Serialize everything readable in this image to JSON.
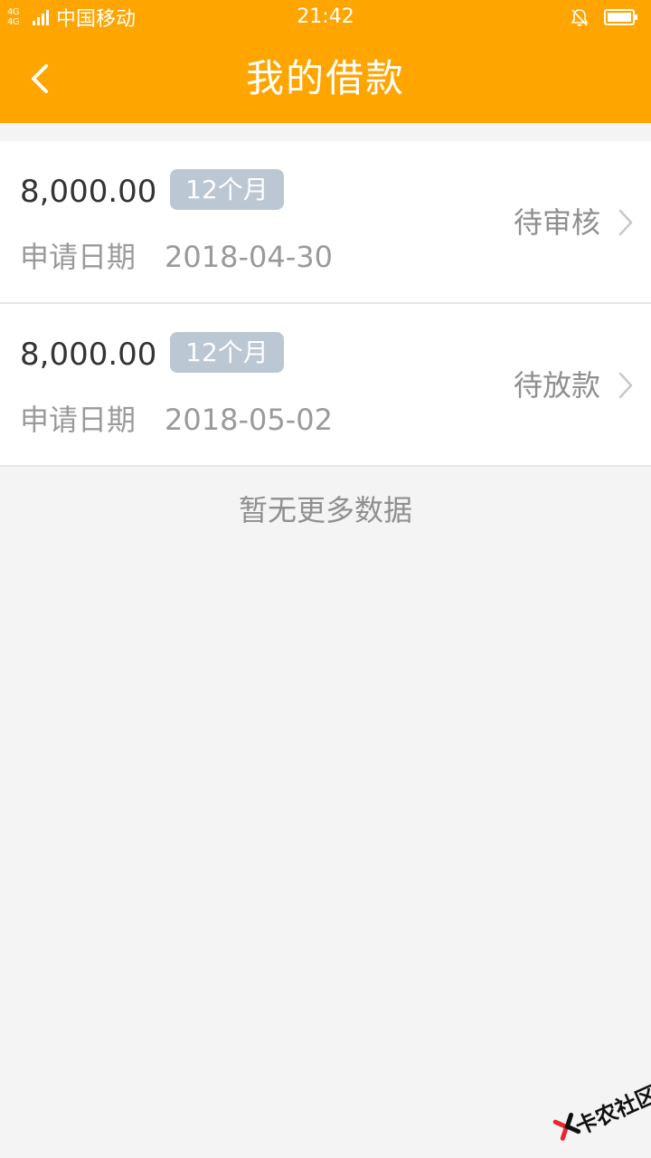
{
  "status_bar": {
    "network_type": "4G 4G",
    "carrier": "中国移动",
    "time": "21:42"
  },
  "header": {
    "title": "我的借款"
  },
  "loans": [
    {
      "amount": "8,000.00",
      "term": "12个月",
      "date_label": "申请日期",
      "date": "2018-04-30",
      "status": "待审核"
    },
    {
      "amount": "8,000.00",
      "term": "12个月",
      "date_label": "申请日期",
      "date": "2018-05-02",
      "status": "待放款"
    }
  ],
  "footer": {
    "no_more_text": "暂无更多数据"
  },
  "watermark": {
    "text": "卡农社区"
  },
  "colors": {
    "header_bg": "#ffa500",
    "badge_bg": "#bcc7d4",
    "page_bg": "#f4f4f4"
  },
  "icons": {
    "back": "chevron-left-icon",
    "row_arrow": "chevron-right-icon",
    "silent": "bell-off-icon",
    "battery": "battery-icon",
    "signal": "signal-icon"
  }
}
